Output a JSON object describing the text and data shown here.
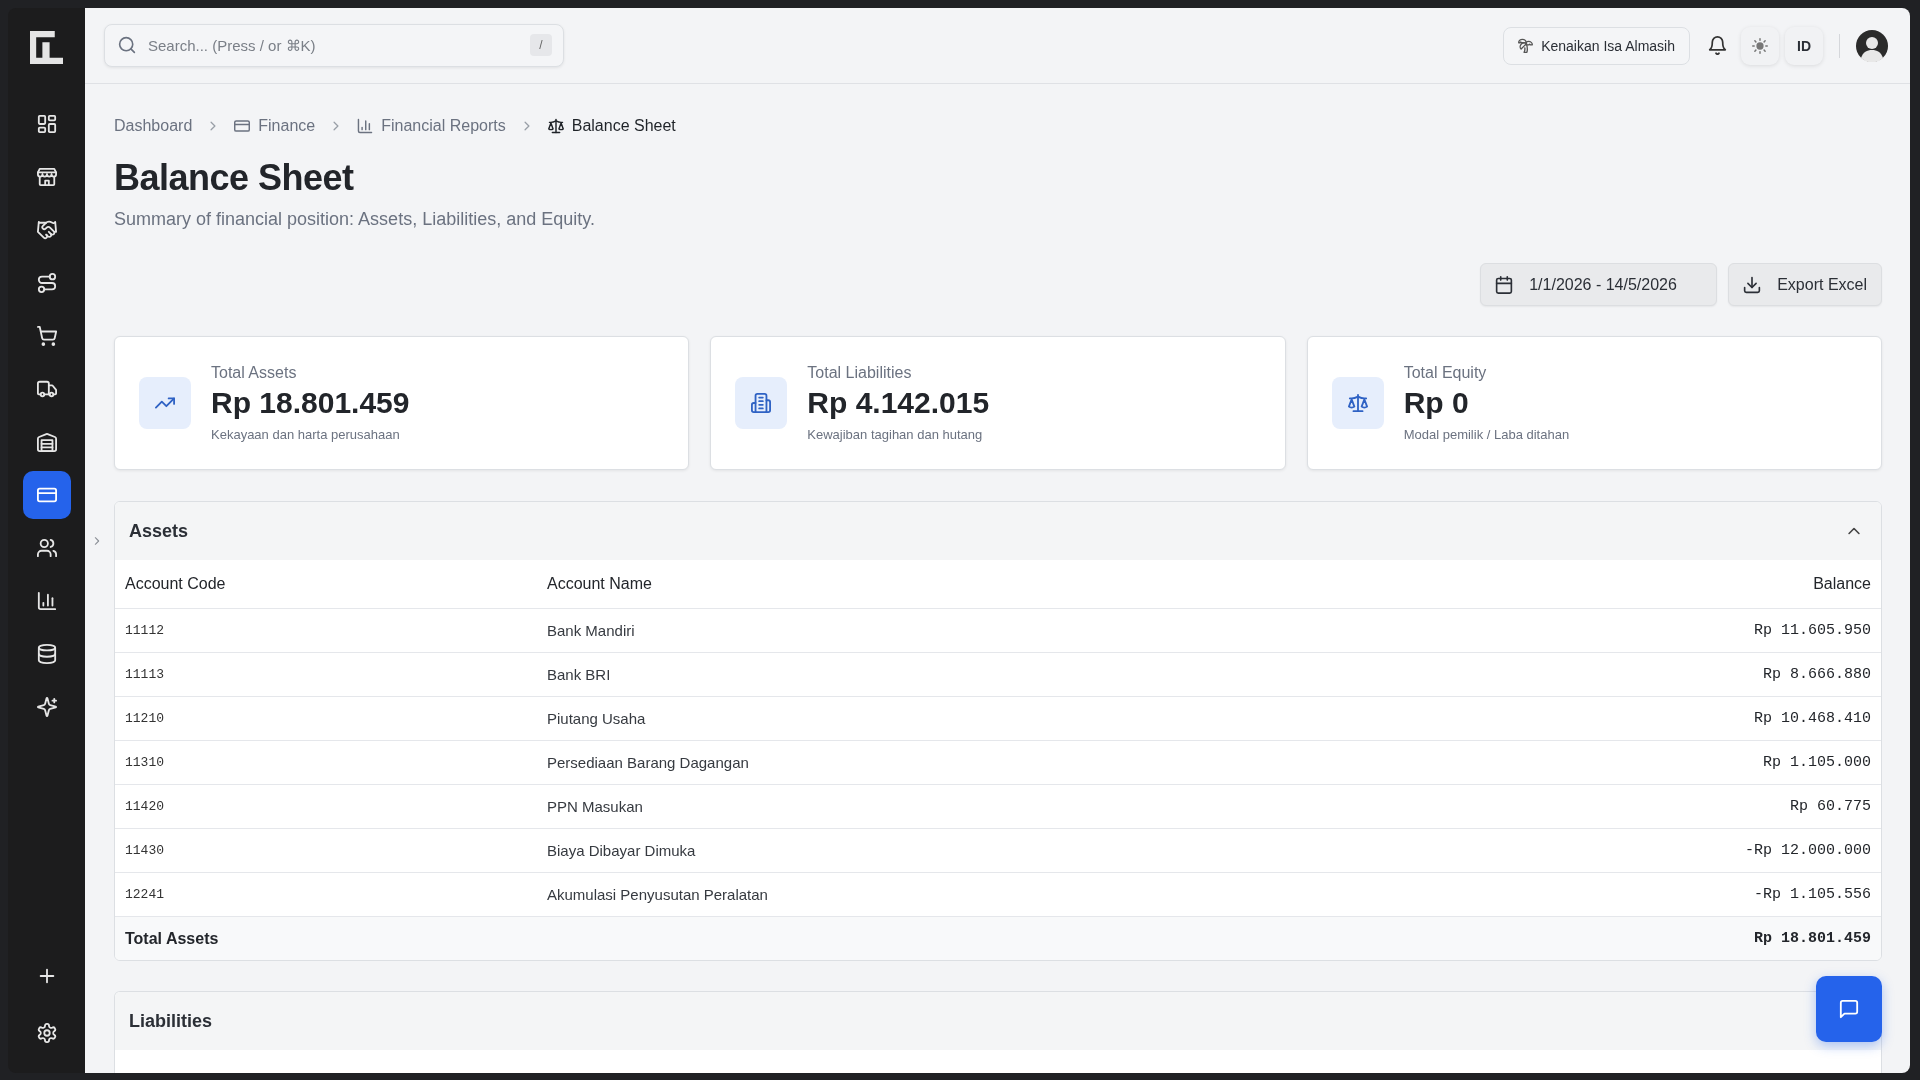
{
  "sidebar": {
    "items": [
      {
        "selected": false
      },
      {
        "selected": false
      },
      {
        "selected": false
      },
      {
        "selected": false
      },
      {
        "selected": false
      },
      {
        "selected": false
      },
      {
        "selected": false
      },
      {
        "selected": true
      },
      {
        "selected": false
      },
      {
        "selected": false
      },
      {
        "selected": false
      },
      {
        "selected": false
      }
    ]
  },
  "topbar": {
    "search": {
      "placeholder": "Search... (Press / or ⌘K)",
      "shortcut": "/"
    },
    "holiday": "Kenaikan Isa Almasih",
    "language": "ID"
  },
  "breadcrumb": [
    {
      "label": "Dashboard",
      "current": false
    },
    {
      "label": "Finance",
      "current": false
    },
    {
      "label": "Financial Reports",
      "current": false
    },
    {
      "label": "Balance Sheet",
      "current": true
    }
  ],
  "page": {
    "title": "Balance Sheet",
    "subtitle": "Summary of financial position: Assets, Liabilities, and Equity."
  },
  "actions": {
    "date_range": "1/1/2026 - 14/5/2026",
    "export": "Export Excel"
  },
  "summary_cards": [
    {
      "label": "Total Assets",
      "value": "Rp 18.801.459",
      "note": "Kekayaan dan harta perusahaan"
    },
    {
      "label": "Total Liabilities",
      "value": "Rp 4.142.015",
      "note": "Kewajiban tagihan dan hutang"
    },
    {
      "label": "Total Equity",
      "value": "Rp 0",
      "note": "Modal pemilik / Laba ditahan"
    }
  ],
  "sections": [
    {
      "title": "Assets",
      "expanded": true,
      "columns": [
        "Account Code",
        "Account Name",
        "Balance"
      ],
      "rows": [
        {
          "code": "11112",
          "name": "Bank Mandiri",
          "balance": "Rp 11.605.950"
        },
        {
          "code": "11113",
          "name": "Bank BRI",
          "balance": "Rp 8.666.880"
        },
        {
          "code": "11210",
          "name": "Piutang Usaha",
          "balance": "Rp 10.468.410"
        },
        {
          "code": "11310",
          "name": "Persediaan Barang Dagangan",
          "balance": "Rp 1.105.000"
        },
        {
          "code": "11420",
          "name": "PPN Masukan",
          "balance": "Rp 60.775"
        },
        {
          "code": "11430",
          "name": "Biaya Dibayar Dimuka",
          "balance": "-Rp 12.000.000"
        },
        {
          "code": "12241",
          "name": "Akumulasi Penyusutan Peralatan",
          "balance": "-Rp 1.105.556"
        }
      ],
      "total": {
        "label": "Total Assets",
        "balance": "Rp 18.801.459"
      }
    },
    {
      "title": "Liabilities"
    }
  ]
}
